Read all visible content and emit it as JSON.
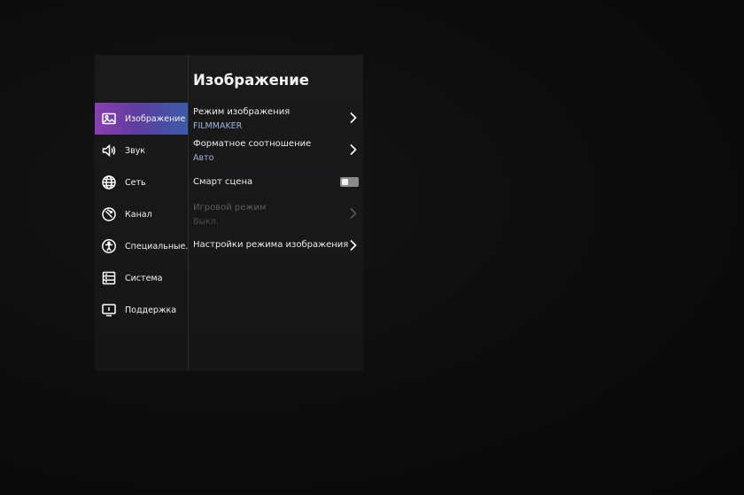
{
  "sidebar": {
    "items": [
      {
        "label": "Изображение",
        "icon": "picture-icon",
        "active": true
      },
      {
        "label": "Звук",
        "icon": "speaker-icon",
        "active": false
      },
      {
        "label": "Сеть",
        "icon": "globe-icon",
        "active": false
      },
      {
        "label": "Канал",
        "icon": "antenna-icon",
        "active": false
      },
      {
        "label": "Специальные...",
        "icon": "accessibility-icon",
        "active": false
      },
      {
        "label": "Система",
        "icon": "server-icon",
        "active": false
      },
      {
        "label": "Поддержка",
        "icon": "monitor-icon",
        "active": false
      }
    ]
  },
  "main": {
    "title": "Изображение",
    "rows": [
      {
        "label": "Режим изображения",
        "value": "FILMMAKER",
        "control": "chevron",
        "enabled": true
      },
      {
        "label": "Форматное соотношение",
        "value": "Авто",
        "control": "chevron",
        "enabled": true
      },
      {
        "label": "Смарт сцена",
        "value": "",
        "control": "toggle",
        "toggle_on": false,
        "enabled": true
      },
      {
        "label": "Игровой режим",
        "value": "Выкл.",
        "control": "chevron",
        "enabled": false
      },
      {
        "label": "Настройки режима изображения",
        "value": "",
        "control": "chevron",
        "enabled": true
      }
    ]
  },
  "colors": {
    "active_gradient_start": "#8a3fae",
    "active_gradient_end": "#3b5ba8",
    "value_text": "#9fb4de",
    "disabled_text": "#5d5d5f"
  }
}
